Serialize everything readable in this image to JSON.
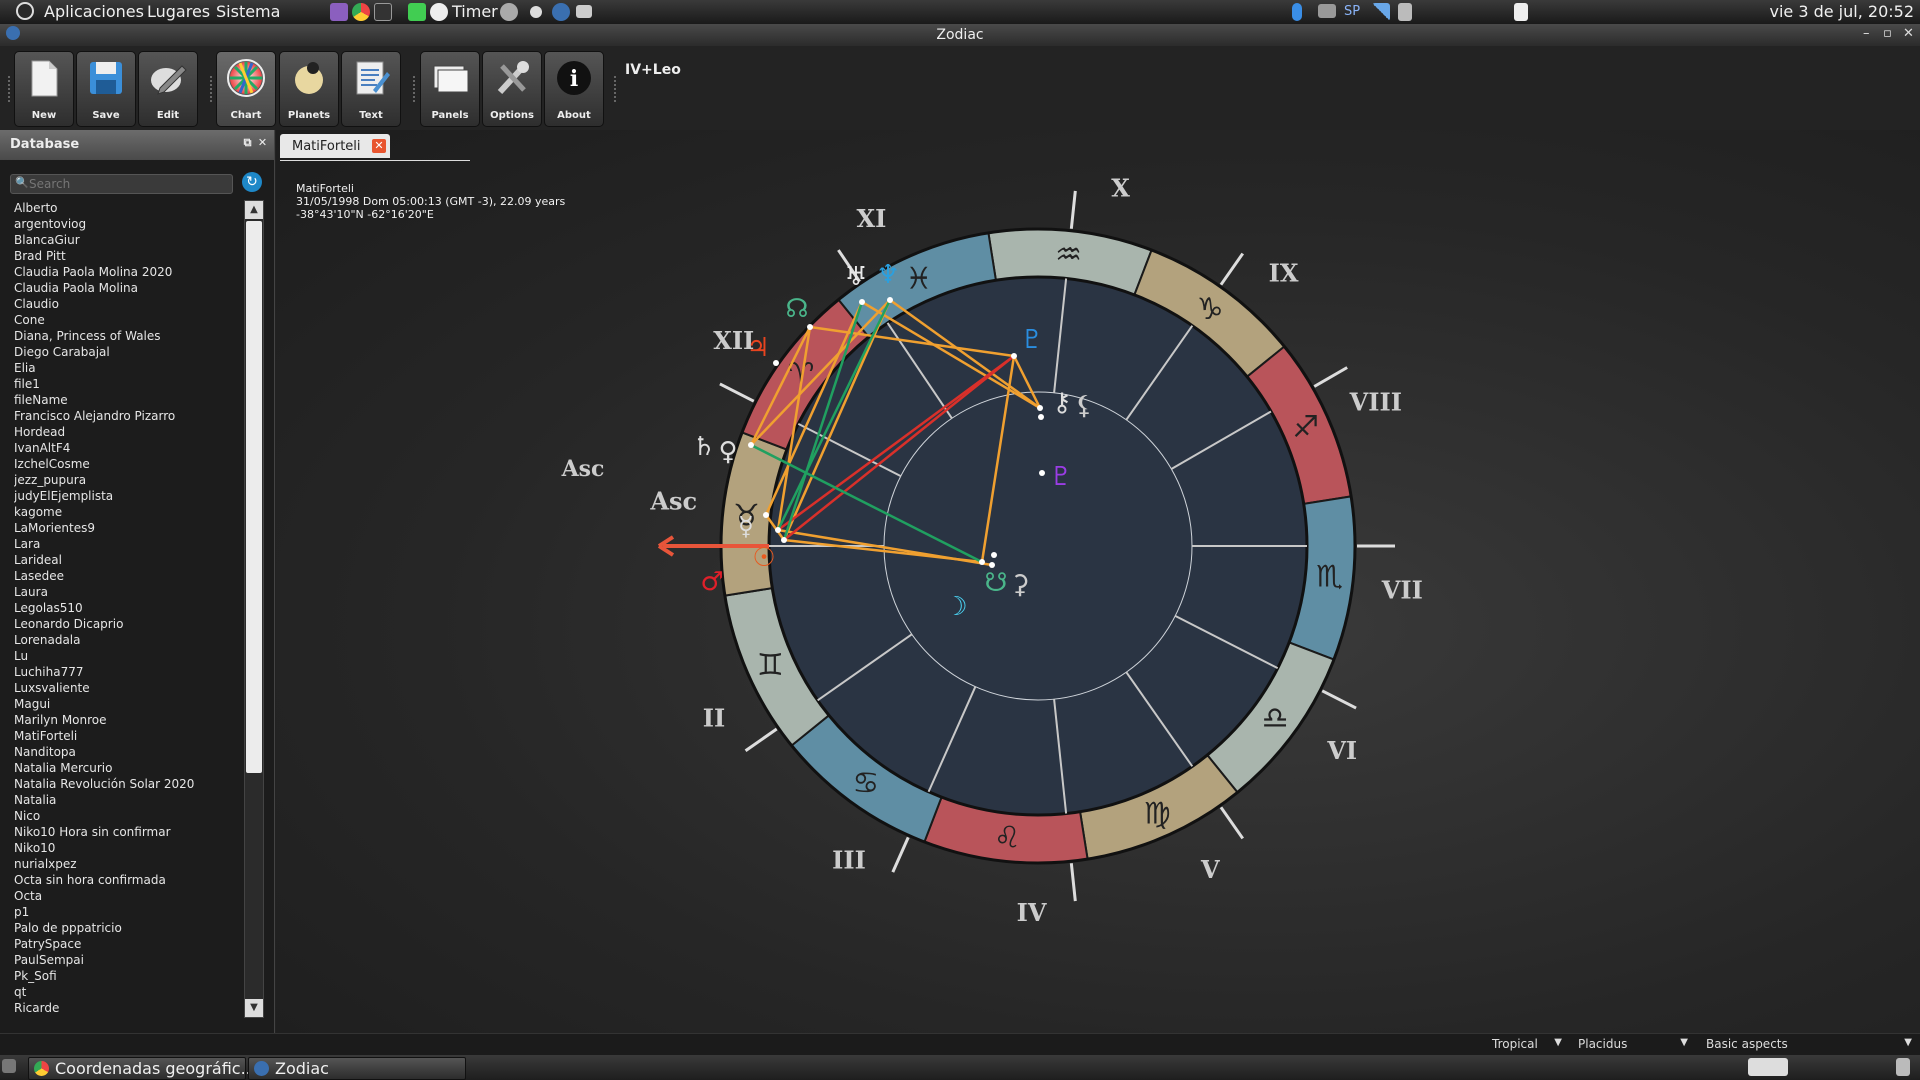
{
  "top_panel": {
    "menus": [
      "Aplicaciones",
      "Lugares",
      "Sistema"
    ],
    "timer_label": "Timer",
    "keyboard_layout": "SP",
    "clock": "vie  3 de jul, 20:52"
  },
  "window": {
    "title": "Zodiac",
    "controls": [
      "–",
      "▫",
      "✕"
    ]
  },
  "toolbar": {
    "buttons": [
      {
        "label": "New",
        "icon": "new-document-icon"
      },
      {
        "label": "Save",
        "icon": "floppy-disk-icon"
      },
      {
        "label": "Edit",
        "icon": "edit-pencil-icon"
      },
      {
        "label": "Chart",
        "icon": "color-wheel-icon"
      },
      {
        "label": "Planets",
        "icon": "planets-icon"
      },
      {
        "label": "Text",
        "icon": "text-document-icon"
      },
      {
        "label": "Panels",
        "icon": "panels-icon"
      },
      {
        "label": "Options",
        "icon": "tools-icon"
      },
      {
        "label": "About",
        "icon": "info-icon"
      }
    ],
    "chart_name": "IV+Leo"
  },
  "sidebar": {
    "title": "Database",
    "search_placeholder": "Search",
    "items": [
      "Alberto",
      "argentoviog",
      "BlancaGiur",
      "Brad Pitt",
      "Claudia Paola Molina 2020",
      "Claudia Paola Molina",
      "Claudio",
      "Cone",
      "Diana, Princess of Wales",
      "Diego Carabajal",
      "Elia",
      "file1",
      "fileName",
      "Francisco Alejandro Pizarro",
      "Hordead",
      "IvanAltF4",
      "IzchelCosme",
      "jezz_pupura",
      "judyElEjemplista",
      "kagome",
      "LaMorientes9",
      "Lara",
      "Larideal",
      "Lasedee",
      "Laura",
      "Legolas510",
      "Leonardo Dicaprio",
      "Lorenadala",
      "Lu",
      "Luchiha777",
      "Luxsvaliente",
      "Magui",
      "Marilyn Monroe",
      "MatiForteli",
      "Nanditopa",
      "Natalia Mercurio",
      "Natalia Revolución Solar 2020",
      "Natalia",
      "Nico",
      "Niko10 Hora sin confirmar",
      "Niko10",
      "nurialxpez",
      "Octa sin hora confirmada",
      "Octa",
      "p1",
      "Palo de pppatricio",
      "PatrySpace",
      "PaulSempai",
      "Pk_Sofi",
      "qt",
      "Ricarde"
    ]
  },
  "tab": {
    "label": "MatiForteli",
    "close": "✕"
  },
  "chart_info": {
    "name": "MatiForteli",
    "datetime": "31/05/1998 Dom 05:00:13 (GMT -3), 22.09 years",
    "coords": "-38°43'10\"N  -62°16'20\"E"
  },
  "wheel": {
    "houses": [
      "X",
      "IX",
      "VIII",
      "VII",
      "VI",
      "V",
      "IV",
      "III",
      "II",
      "Asc",
      "XII",
      "XI"
    ],
    "signs": [
      "♒",
      "♑",
      "♐",
      "♏",
      "♎",
      "♍",
      "♌",
      "♋",
      "♊",
      "♉",
      "♈",
      "♓"
    ],
    "planets": [
      "♅",
      "♆",
      "☊",
      "♃",
      "♇",
      "⚷",
      "⚸",
      "♄",
      "♀",
      "☿",
      "☉",
      "♂",
      "☽",
      "☋",
      "⚳"
    ],
    "asc_label": "Asc",
    "colors": {
      "fire": "#b9545a",
      "earth": "#b3a27d",
      "air": "#a9b5ad",
      "water": "#5f8ea4",
      "trine": "#f0a030",
      "opposition": "#d9302a",
      "sextile": "#20a060"
    }
  },
  "statusbar": {
    "zodiac": "Tropical",
    "house_system": "Placidus",
    "aspects": "Basic aspects"
  },
  "taskbar": {
    "tasks": [
      "Coordenadas geográfic...",
      "Zodiac"
    ]
  }
}
